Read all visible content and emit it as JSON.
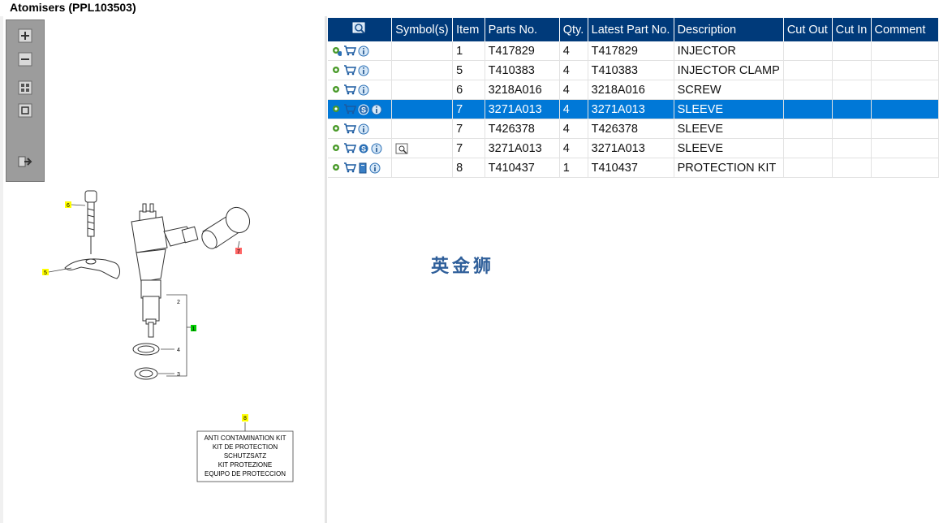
{
  "window": {
    "title": "Atomisers (PPL103503)"
  },
  "toolbar": {
    "buttons": [
      "zoom-in-icon",
      "zoom-out-icon",
      "fit-all-icon",
      "fit-window-icon",
      "export-icon"
    ]
  },
  "diagram": {
    "callouts": {
      "c6": "6",
      "c5": "5",
      "c7": "7",
      "c1": "1",
      "c2": "2",
      "c4": "4",
      "c3": "3",
      "c8": "8"
    },
    "kit_label": [
      "ANTI CONTAMINATION KIT",
      "KIT DE PROTECTION",
      "SCHUTZSATZ",
      "KIT PROTEZIONE",
      "EQUIPO DE PROTECCION"
    ],
    "callout_colors": {
      "yellow": "#ffff00",
      "green": "#00cc00",
      "red": "#ff6666"
    }
  },
  "table": {
    "headers": {
      "symbols": "Symbol(s)",
      "item": "Item",
      "parts_no": "Parts No.",
      "qty": "Qty.",
      "latest": "Latest Part No.",
      "description": "Description",
      "cut_out": "Cut Out",
      "cut_in": "Cut In",
      "comment": "Comment"
    },
    "rows": [
      {
        "item": "1",
        "parts_no": "T417829",
        "qty": "4",
        "latest": "T417829",
        "description": "INJECTOR"
      },
      {
        "item": "5",
        "parts_no": "T410383",
        "qty": "4",
        "latest": "T410383",
        "description": "INJECTOR CLAMP"
      },
      {
        "item": "6",
        "parts_no": "3218A016",
        "qty": "4",
        "latest": "3218A016",
        "description": "SCREW"
      },
      {
        "item": "7",
        "parts_no": "3271A013",
        "qty": "4",
        "latest": "3271A013",
        "description": "SLEEVE"
      },
      {
        "item": "7",
        "parts_no": "T426378",
        "qty": "4",
        "latest": "T426378",
        "description": "SLEEVE"
      },
      {
        "item": "7",
        "parts_no": "3271A013",
        "qty": "4",
        "latest": "3271A013",
        "description": "SLEEVE"
      },
      {
        "item": "8",
        "parts_no": "T410437",
        "qty": "1",
        "latest": "T410437",
        "description": "PROTECTION KIT"
      }
    ],
    "selected_row": 3
  },
  "watermark": "英金狮",
  "colors": {
    "header_bg": "#003a7a",
    "selection": "#0078d7",
    "toolbar": "#9c9c9c"
  }
}
